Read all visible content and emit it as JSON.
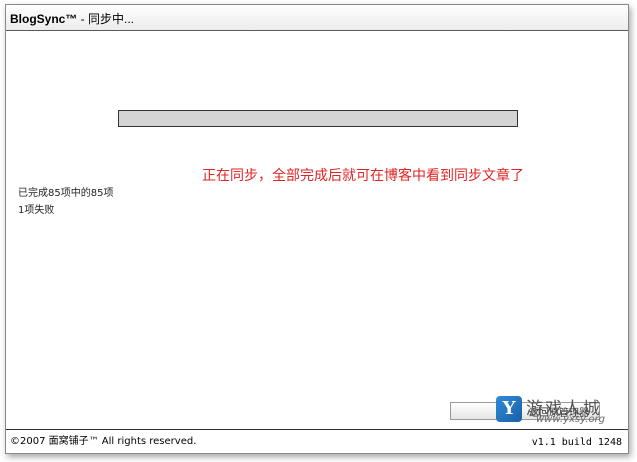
{
  "window": {
    "title": "BlogSync™",
    "subtitle": " - 同步中..."
  },
  "progress": {
    "fraction": 1.0,
    "fill_color": "#d4d4d4"
  },
  "status": {
    "completed": "已完成85项中的85项",
    "failed": "1项失败"
  },
  "annotation": {
    "text": "正在同步，全部完成后就可在博客中看到同步文章了",
    "color": "#e02424"
  },
  "action_button": {
    "label": "返回原管理器"
  },
  "watermark": {
    "badge": "Y",
    "chars": "游戏人城",
    "url": "www.yxsy.org"
  },
  "footer": {
    "copyright": "©2007 面窝铺子™ All rights reserved.",
    "version": "v1.1 build 1248"
  }
}
